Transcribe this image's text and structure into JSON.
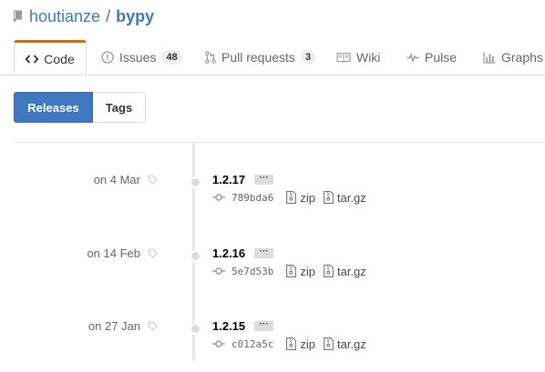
{
  "repo": {
    "owner": "houtianze",
    "separator": "/",
    "name": "bypy"
  },
  "tabs": [
    {
      "label": "Code",
      "icon": "code-icon",
      "selected": true
    },
    {
      "label": "Issues",
      "icon": "issue-opened-icon",
      "count": "48"
    },
    {
      "label": "Pull requests",
      "icon": "git-pull-request-icon",
      "count": "3"
    },
    {
      "label": "Wiki",
      "icon": "book-icon"
    },
    {
      "label": "Pulse",
      "icon": "pulse-icon"
    },
    {
      "label": "Graphs",
      "icon": "graph-icon"
    }
  ],
  "subnav": {
    "releases": "Releases",
    "tags": "Tags"
  },
  "colors": {
    "accent": "#4078c0",
    "tab_highlight": "#d26911"
  },
  "releases": [
    {
      "date": "on 4 Mar",
      "version": "1.2.17",
      "ellipsis": "···",
      "sha": "789bda6",
      "zip": "zip",
      "targz": "tar.gz"
    },
    {
      "date": "on 14 Feb",
      "version": "1.2.16",
      "ellipsis": "···",
      "sha": "5e7d53b",
      "zip": "zip",
      "targz": "tar.gz"
    },
    {
      "date": "on 27 Jan",
      "version": "1.2.15",
      "ellipsis": "···",
      "sha": "c012a5c",
      "zip": "zip",
      "targz": "tar.gz"
    }
  ]
}
